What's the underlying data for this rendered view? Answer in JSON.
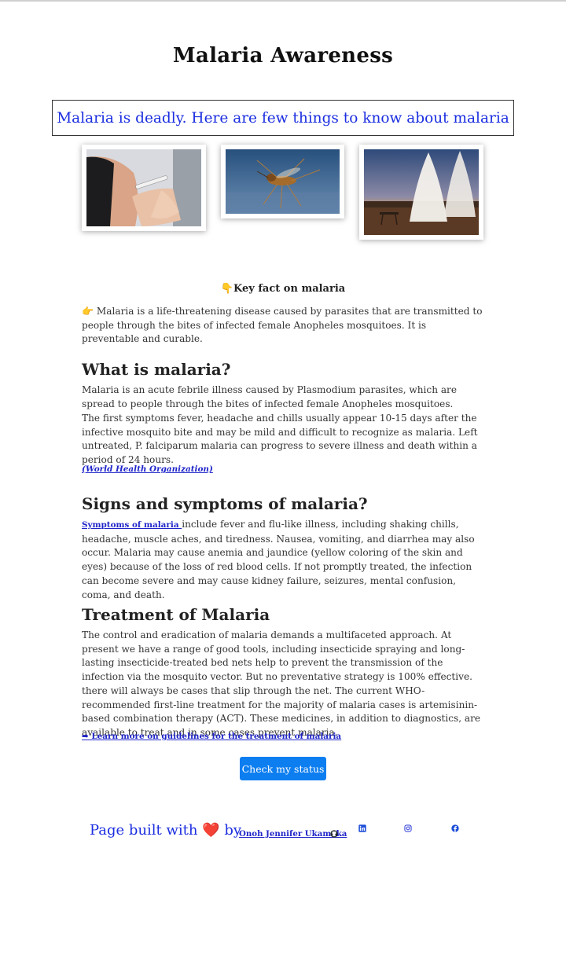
{
  "page": {
    "title": "Malaria Awareness",
    "banner": "Malaria is deadly. Here are few things to know about malaria"
  },
  "images": [
    {
      "name": "vaccination-photo",
      "alt": "Vaccination"
    },
    {
      "name": "mosquito-photo",
      "alt": "Mosquito"
    },
    {
      "name": "bed-nets-photo",
      "alt": "Bed nets"
    }
  ],
  "key_fact": {
    "icon": "pointing-down-icon",
    "icon_glyph": "👇",
    "heading": "Key fact on malaria",
    "bullet_icon": "pointing-right-icon",
    "bullet_glyph": "👉",
    "text": " Malaria is a life-threatening disease caused by parasites that are transmitted to people through the bites of infected female Anopheles mosquitoes. It is preventable and curable."
  },
  "what": {
    "heading": "What is malaria?",
    "p1": "Malaria is an acute febrile illness caused by Plasmodium parasites, which are spread to people through the bites of infected female Anopheles mosquitoes.",
    "p2": "The first symptoms fever, headache and chills usually appear 10-15 days after the infective mosquito bite and may be mild and difficult to recognize as malaria. Left untreated, P. falciparum malaria can progress to severe illness and death within a period of 24 hours.",
    "source": "(World Health Organization)"
  },
  "signs": {
    "heading": "Signs and symptoms of malaria?",
    "link": "Symptoms of malaria ",
    "text": "include fever and flu-like illness, including shaking chills, headache, muscle aches, and tiredness. Nausea, vomiting, and diarrhea may also occur. Malaria may cause anemia and jaundice (yellow coloring of the skin and eyes) because of the loss of red blood cells. If not promptly treated, the infection can become severe and may cause kidney failure, seizures, mental confusion, coma, and death."
  },
  "treatment": {
    "heading": "Treatment of Malaria",
    "text": "The control and eradication of malaria demands a multifaceted approach. At present we have a range of good tools, including insecticide spraying and long-lasting insecticide-treated bed nets help to prevent the transmission of the infection via the mosquito vector. But no preventative strategy is 100% effective. there will always be cases that slip through the net. The current WHO-recommended first-line treatment for the majority of malaria cases is artemisinin-based combination therapy (ACT). These medicines, in addition to diagnostics, are available to treat and in some cases prevent malaria.",
    "learn_more": "➡ Learn more on guidelines for the treatment of malaria"
  },
  "cta": {
    "label": "Check my status"
  },
  "footer": {
    "prefix": "Page built with ",
    "heart": "❤️",
    "by": " by ",
    "author": "Onoh Jennifer Ukamaka",
    "icons": [
      "github-icon",
      "linkedin-icon",
      "instagram-icon",
      "facebook-icon"
    ]
  },
  "colors": {
    "link": "#1f25c9",
    "banner_text": "#1b2ee0",
    "button": "#0d7ef0"
  }
}
